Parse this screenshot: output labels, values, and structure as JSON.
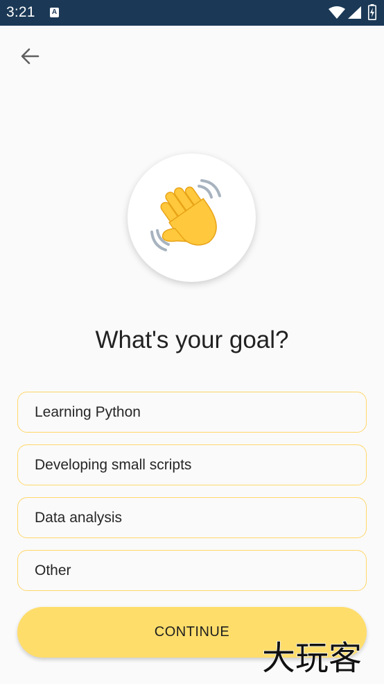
{
  "status_bar": {
    "time": "3:21",
    "notification_icon_letter": "A",
    "icons": [
      "wifi-icon",
      "signal-icon",
      "battery-icon"
    ],
    "background": "#1b3956"
  },
  "header": {
    "back_icon": "arrow-left-icon"
  },
  "hero": {
    "icon": "waving-hand-icon"
  },
  "title": "What's your goal?",
  "options": [
    {
      "label": "Learning Python"
    },
    {
      "label": "Developing small scripts"
    },
    {
      "label": "Data analysis"
    },
    {
      "label": "Other"
    }
  ],
  "continue_label": "CONTINUE",
  "watermark": {
    "text": "大玩客"
  },
  "colors": {
    "accent": "#ffdd6b",
    "option_border": "#ffd76a",
    "background": "#fafafa"
  }
}
